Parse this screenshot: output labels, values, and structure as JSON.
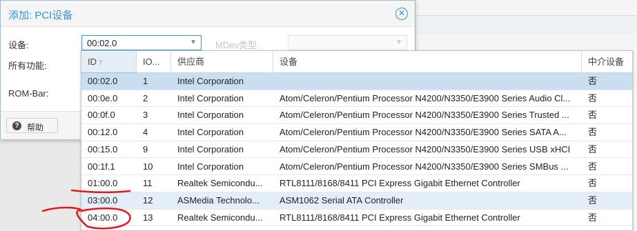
{
  "dialog": {
    "title": "添加: PCI设备",
    "labels": {
      "device": "设备:",
      "all_functions": "所有功能:",
      "rom_bar": "ROM-Bar:",
      "mdev_type": "MDev类型:"
    },
    "device_combo_value": "00:02.0",
    "help_button": "帮助"
  },
  "grid": {
    "columns": [
      "ID",
      "IO...",
      "供应商",
      "设备",
      "中介设备"
    ],
    "sort_icon": "sort-ascending-icon",
    "rows": [
      {
        "id": "00:02.0",
        "iommu": "1",
        "vendor": "Intel Corporation",
        "device": "",
        "mdev": "否"
      },
      {
        "id": "00:0e.0",
        "iommu": "2",
        "vendor": "Intel Corporation",
        "device": "Atom/Celeron/Pentium Processor N4200/N3350/E3900 Series Audio Cl...",
        "mdev": "否"
      },
      {
        "id": "00:0f.0",
        "iommu": "3",
        "vendor": "Intel Corporation",
        "device": "Atom/Celeron/Pentium Processor N4200/N3350/E3900 Series Trusted ...",
        "mdev": "否"
      },
      {
        "id": "00:12.0",
        "iommu": "4",
        "vendor": "Intel Corporation",
        "device": "Atom/Celeron/Pentium Processor N4200/N3350/E3900 Series SATA A...",
        "mdev": "否"
      },
      {
        "id": "00:15.0",
        "iommu": "9",
        "vendor": "Intel Corporation",
        "device": "Atom/Celeron/Pentium Processor N4200/N3350/E3900 Series USB xHCI",
        "mdev": "否"
      },
      {
        "id": "00:1f.1",
        "iommu": "10",
        "vendor": "Intel Corporation",
        "device": "Atom/Celeron/Pentium Processor N4200/N3350/E3900 Series SMBus ...",
        "mdev": "否"
      },
      {
        "id": "01:00.0",
        "iommu": "11",
        "vendor": "Realtek Semicondu...",
        "device": "RTL8111/8168/8411 PCI Express Gigabit Ethernet Controller",
        "mdev": "否"
      },
      {
        "id": "03:00.0",
        "iommu": "12",
        "vendor": "ASMedia Technolo...",
        "device": "ASM1062 Serial ATA Controller",
        "mdev": "否"
      },
      {
        "id": "04:00.0",
        "iommu": "13",
        "vendor": "Realtek Semicondu...",
        "device": "RTL8111/8168/8411 PCI Express Gigabit Ethernet Controller",
        "mdev": "否"
      }
    ]
  },
  "colors": {
    "accent": "#3892d4",
    "selected_row": "#c8dff2",
    "annotation_red": "#e8151b"
  }
}
